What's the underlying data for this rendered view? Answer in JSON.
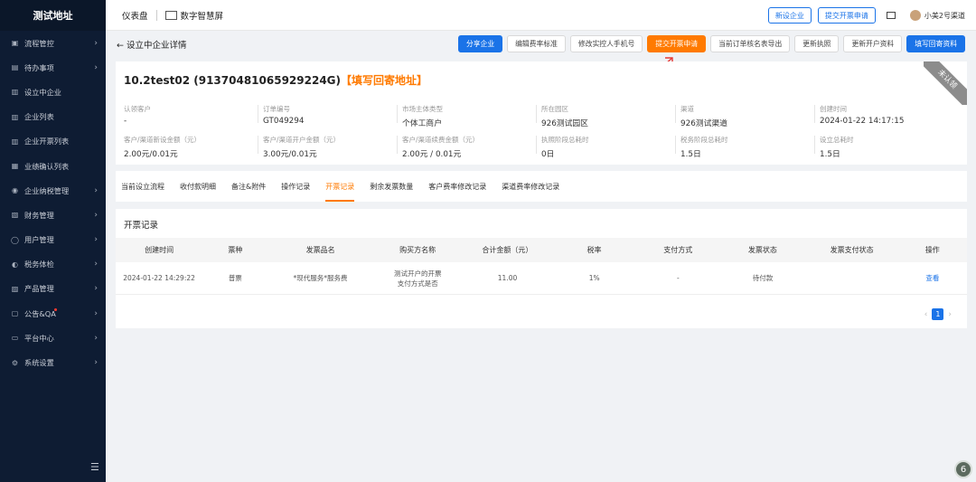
{
  "sidebar": {
    "logo": "测试地址",
    "items": [
      {
        "label": "流程管控",
        "icon": "flow-icon",
        "has_arrow": true
      },
      {
        "label": "待办事项",
        "icon": "todo-icon",
        "has_arrow": true
      },
      {
        "label": "设立中企业",
        "icon": "building-icon",
        "has_arrow": false
      },
      {
        "label": "企业列表",
        "icon": "building-icon",
        "has_arrow": false
      },
      {
        "label": "企业开票列表",
        "icon": "building-icon",
        "has_arrow": false
      },
      {
        "label": "业绩确认列表",
        "icon": "check-icon",
        "has_arrow": false
      },
      {
        "label": "企业纳税管理",
        "icon": "tax-icon",
        "has_arrow": true
      },
      {
        "label": "财务管理",
        "icon": "finance-icon",
        "has_arrow": true
      },
      {
        "label": "用户管理",
        "icon": "user-icon",
        "has_arrow": true
      },
      {
        "label": "税务体检",
        "icon": "health-icon",
        "has_arrow": true
      },
      {
        "label": "产品管理",
        "icon": "product-icon",
        "has_arrow": true
      },
      {
        "label": "公告&QA",
        "icon": "notice-icon",
        "has_arrow": true,
        "has_dot": true
      },
      {
        "label": "平台中心",
        "icon": "platform-icon",
        "has_arrow": true
      },
      {
        "label": "系统设置",
        "icon": "settings-icon",
        "has_arrow": true
      }
    ]
  },
  "topbar": {
    "dashboard": "仪表盘",
    "screen": "数字智慧屏",
    "new_company": "新设企业",
    "submit_invoice": "提交开票申请",
    "user_name": "小美2号渠道"
  },
  "page": {
    "back_title": "← 设立中企业详情",
    "actions": [
      {
        "label": "分享企业",
        "style": "primary"
      },
      {
        "label": "编辑费率标准",
        "style": "default"
      },
      {
        "label": "修改实控人手机号",
        "style": "default"
      },
      {
        "label": "提交开票申请",
        "style": "orange"
      },
      {
        "label": "当前订单核名表导出",
        "style": "default"
      },
      {
        "label": "更新执照",
        "style": "default"
      },
      {
        "label": "更新开户资料",
        "style": "default"
      },
      {
        "label": "填写回寄资料",
        "style": "primary"
      }
    ]
  },
  "company": {
    "title": "10.2test02 (91370481065929224G)",
    "title_highlight": "【填写回寄地址】",
    "corner_badge": "未认领",
    "row1": [
      {
        "label": "认领客户",
        "value": "-"
      },
      {
        "label": "订单编号",
        "value": "GT049294"
      },
      {
        "label": "市场主体类型",
        "value": "个体工商户"
      },
      {
        "label": "所在园区",
        "value": "926测试园区"
      },
      {
        "label": "渠道",
        "value": "926测试渠道"
      },
      {
        "label": "创建时间",
        "value": "2024-01-22 14:17:15"
      }
    ],
    "row2": [
      {
        "label": "客户/渠道新设金额（元）",
        "value": "2.00元/0.01元"
      },
      {
        "label": "客户/渠道开户金额（元）",
        "value": "3.00元/0.01元"
      },
      {
        "label": "客户/渠道续费金额（元）",
        "value": "2.00元 / 0.01元"
      },
      {
        "label": "执照阶段总耗时",
        "value": "0日"
      },
      {
        "label": "税务阶段总耗时",
        "value": "1.5日"
      },
      {
        "label": "设立总耗时",
        "value": "1.5日"
      }
    ]
  },
  "tabs": [
    {
      "label": "当前设立流程",
      "active": false
    },
    {
      "label": "收付款明细",
      "active": false
    },
    {
      "label": "备注&附件",
      "active": false
    },
    {
      "label": "操作记录",
      "active": false
    },
    {
      "label": "开票记录",
      "active": true
    },
    {
      "label": "剩余发票数量",
      "active": false
    },
    {
      "label": "客户费率修改记录",
      "active": false
    },
    {
      "label": "渠道费率修改记录",
      "active": false
    }
  ],
  "invoice": {
    "section_title": "开票记录",
    "columns": [
      "创建时间",
      "票种",
      "发票品名",
      "购买方名称",
      "合计金额（元）",
      "税率",
      "支付方式",
      "发票状态",
      "发票支付状态",
      "操作"
    ],
    "rows": [
      [
        "2024-01-22 14:29:22",
        "普票",
        "*现代服务*服务费",
        "测试开户的开票支付方式是否",
        "11.00",
        "1%",
        "-",
        "待付款",
        "",
        "查看"
      ]
    ],
    "page_number": "1"
  },
  "badge": "6"
}
